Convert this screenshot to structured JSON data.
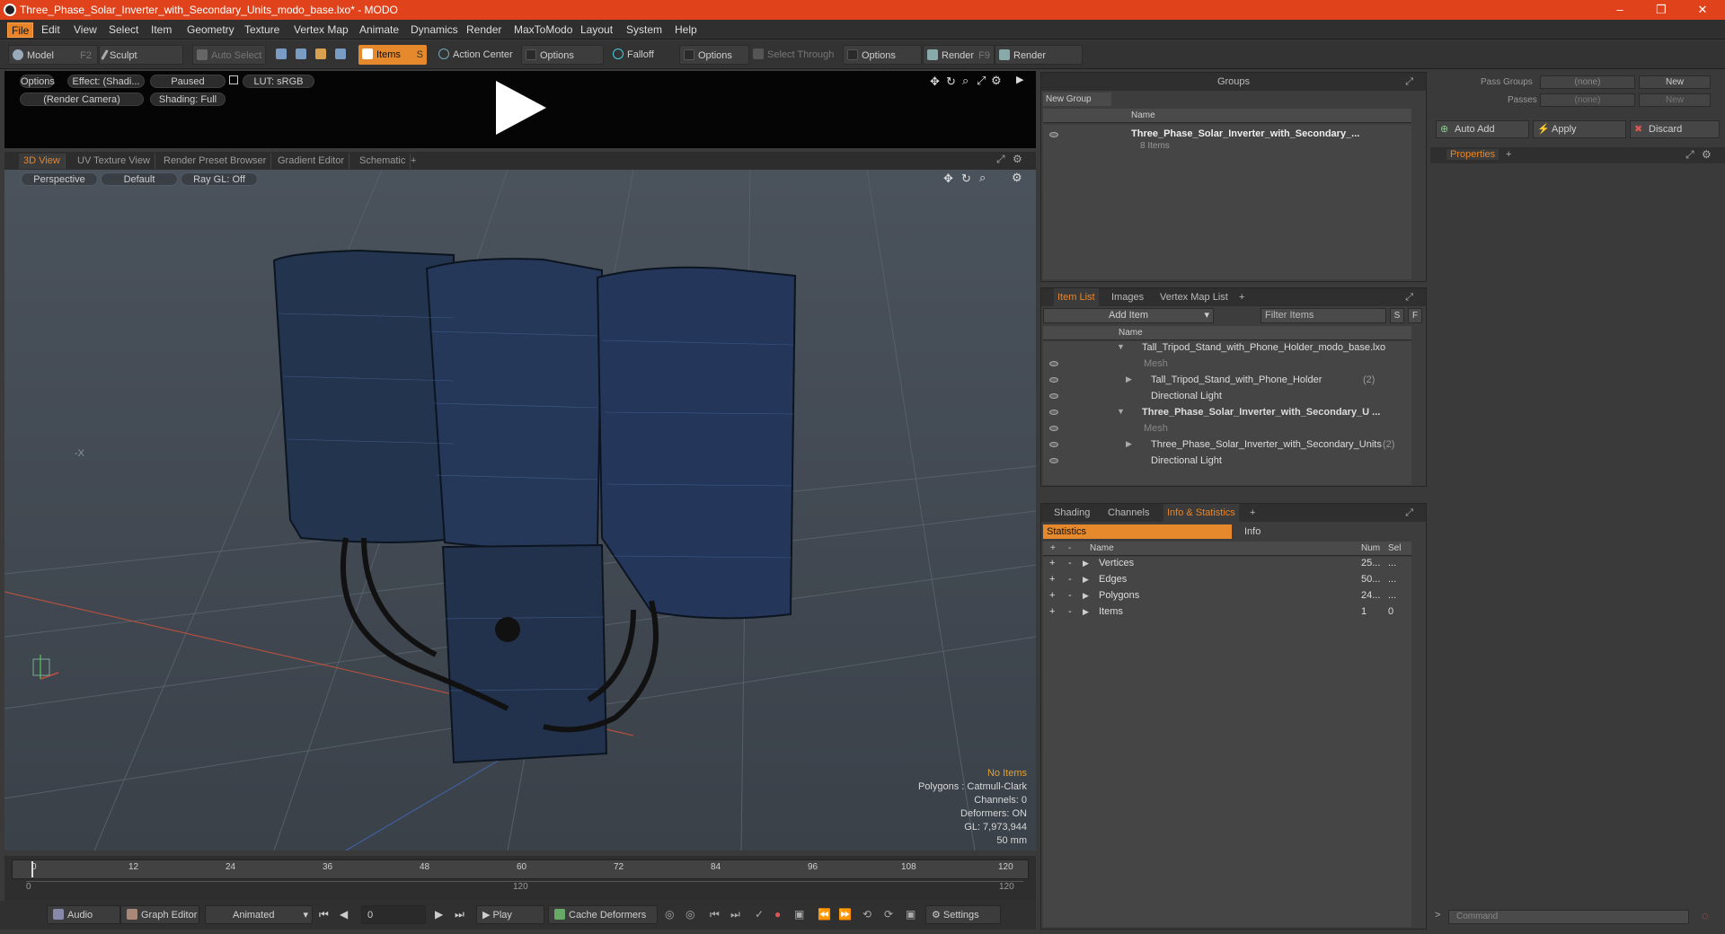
{
  "window": {
    "title": "Three_Phase_Solar_Inverter_with_Secondary_Units_modo_base.lxo* - MODO",
    "min": "–",
    "max": "❐",
    "close": "✕"
  },
  "menu": [
    "File",
    "Edit",
    "View",
    "Select",
    "Item",
    "Geometry",
    "Texture",
    "Vertex Map",
    "Animate",
    "Dynamics",
    "Render",
    "MaxToModo",
    "Layout",
    "System",
    "Help"
  ],
  "toolbar": {
    "model": "Model",
    "model_key": "F2",
    "sculpt": "Sculpt",
    "auto_select": "Auto Select",
    "items": "Items",
    "items_key": "S",
    "action_center": "Action Center",
    "options1": "Options",
    "falloff": "Falloff",
    "options2": "Options",
    "select_through": "Select Through",
    "options3": "Options",
    "render": "Render",
    "render_key": "F9",
    "render_window": "Render Window"
  },
  "preview": {
    "options": "Options",
    "effect": "Effect: (Shadi...",
    "paused": "Paused",
    "lut": "LUT: sRGB",
    "camera": "(Render Camera)",
    "shading": "Shading: Full"
  },
  "viewport_tabs": [
    "3D View",
    "UV Texture View",
    "Render Preset Browser",
    "Gradient Editor",
    "Schematic",
    "+"
  ],
  "viewport": {
    "perspective": "Perspective",
    "default": "Default",
    "raygl": "Ray GL: Off",
    "axis_label": "-X",
    "info": {
      "no_items": "No Items",
      "polygons": "Polygons : Catmull-Clark",
      "channels": "Channels: 0",
      "deformers": "Deformers: ON",
      "gl": "GL: 7,973,944",
      "lens": "50 mm"
    }
  },
  "timeline": {
    "ticks": [
      "0",
      "12",
      "24",
      "36",
      "48",
      "60",
      "72",
      "84",
      "96",
      "108",
      "120"
    ],
    "sub_left": "0",
    "sub_mid": "120",
    "sub_right": "120"
  },
  "bottombar": {
    "audio": "Audio",
    "graph_editor": "Graph Editor",
    "animated": "Animated",
    "frame": "0",
    "play": "Play",
    "cache": "Cache Deformers",
    "settings": "Settings"
  },
  "groups": {
    "title": "Groups",
    "new_group": "New Group",
    "col_name": "Name",
    "item_name": "Three_Phase_Solar_Inverter_with_Secondary_...",
    "item_count": "8 Items"
  },
  "passes": {
    "pass_groups": "Pass Groups",
    "passes": "Passes",
    "none1": "(none)",
    "none2": "(none)",
    "new1": "New",
    "new2": "New",
    "auto_add": "Auto Add",
    "apply": "Apply",
    "discard": "Discard",
    "properties": "Properties",
    "plus": "+"
  },
  "itemlist": {
    "tabs": [
      "Item List",
      "Images",
      "Vertex Map List",
      "+"
    ],
    "add_item": "Add Item",
    "filter": "Filter Items",
    "s": "S",
    "f": "F",
    "col_name": "Name",
    "rows": [
      {
        "label": "Tall_Tripod_Stand_with_Phone_Holder_modo_base.lxo",
        "indent": 0,
        "bold": false,
        "dim": false,
        "count": ""
      },
      {
        "label": "Mesh",
        "indent": 2,
        "bold": false,
        "dim": true,
        "count": ""
      },
      {
        "label": "Tall_Tripod_Stand_with_Phone_Holder",
        "indent": 1,
        "bold": false,
        "dim": false,
        "count": "(2)"
      },
      {
        "label": "Directional Light",
        "indent": 1,
        "bold": false,
        "dim": false,
        "count": ""
      },
      {
        "label": "Three_Phase_Solar_Inverter_with_Secondary_U ...",
        "indent": 0,
        "bold": true,
        "dim": false,
        "count": ""
      },
      {
        "label": "Mesh",
        "indent": 2,
        "bold": false,
        "dim": true,
        "count": ""
      },
      {
        "label": "Three_Phase_Solar_Inverter_with_Secondary_Units",
        "indent": 1,
        "bold": false,
        "dim": false,
        "count": "(2)"
      },
      {
        "label": "Directional Light",
        "indent": 1,
        "bold": false,
        "dim": false,
        "count": ""
      }
    ]
  },
  "stats": {
    "tabs": [
      "Shading",
      "Channels",
      "Info & Statistics",
      "+"
    ],
    "statistics": "Statistics",
    "info": "Info",
    "col_name": "Name",
    "col_num": "Num",
    "col_sel": "Sel",
    "rows": [
      {
        "name": "Vertices",
        "num": "25...",
        "sel": "..."
      },
      {
        "name": "Edges",
        "num": "50...",
        "sel": "..."
      },
      {
        "name": "Polygons",
        "num": "24...",
        "sel": "..."
      },
      {
        "name": "Items",
        "num": "1",
        "sel": "0"
      }
    ]
  },
  "command": {
    "placeholder": "Command"
  }
}
